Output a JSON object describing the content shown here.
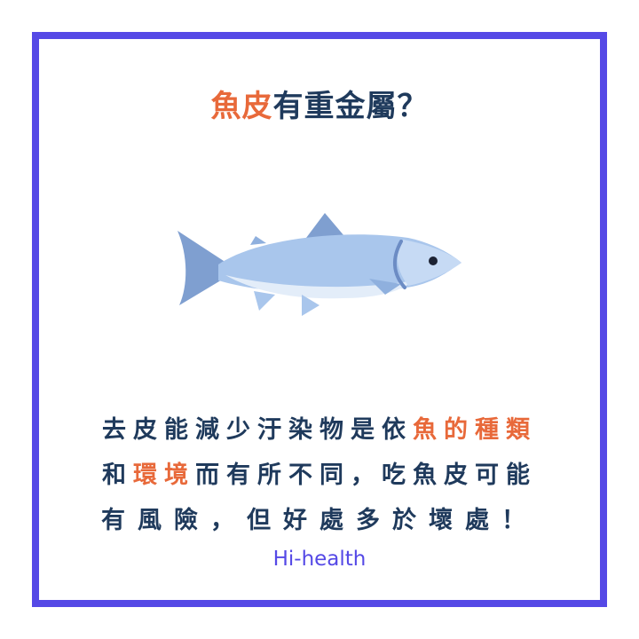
{
  "title": {
    "accent": "魚皮",
    "rest": "有重金屬？"
  },
  "illustration": {
    "icon": "salmon-fish-icon"
  },
  "message": {
    "line1_a": "去皮能減少汙染物是依",
    "line1_accent": "魚的種類",
    "line2_a": "和",
    "line2_accent": "環境",
    "line2_b": "而有所不同，吃魚皮可能",
    "line3": "有風險，但好處多於壞處！"
  },
  "brand": "Hi-health",
  "colors": {
    "border": "#5549e6",
    "accent": "#e8693a",
    "text": "#1f3a5c",
    "brand": "#5549e6"
  }
}
